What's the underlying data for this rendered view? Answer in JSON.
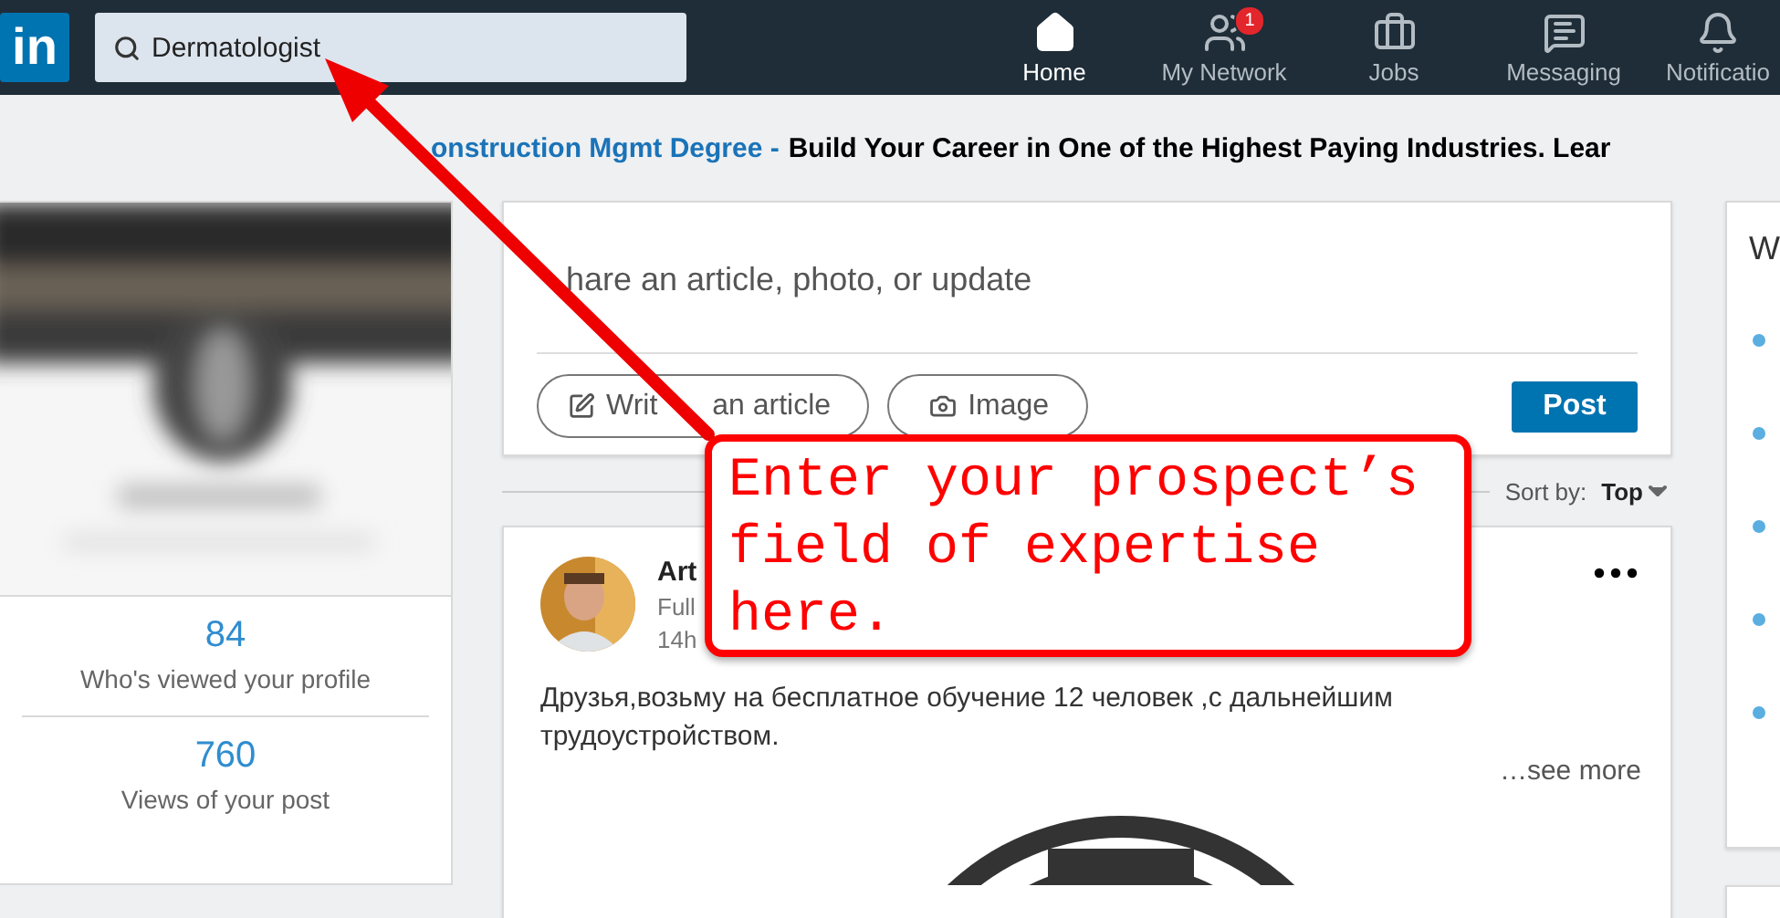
{
  "nav": {
    "logo": "in",
    "search": {
      "value": "Dermatologist"
    },
    "items": [
      {
        "label": "Home",
        "selected": true
      },
      {
        "label": "My Network",
        "selected": false,
        "badge": "1"
      },
      {
        "label": "Jobs",
        "selected": false
      },
      {
        "label": "Messaging",
        "selected": false
      },
      {
        "label": "Notificatio",
        "selected": false
      }
    ]
  },
  "ad": {
    "link": "onstruction Mgmt Degree -",
    "text": "Build Your Career in One of the Highest Paying Industries. Lear"
  },
  "profile": {
    "stats": [
      {
        "value": "84",
        "label": "Who's viewed your profile"
      },
      {
        "value": "760",
        "label": "Views of your post"
      }
    ]
  },
  "share": {
    "placeholder": "hare an article, photo, or update",
    "actions": [
      {
        "kind": "write",
        "label": [
          "Writ",
          "an article"
        ]
      },
      {
        "label": "Image"
      }
    ],
    "post_button": "Post"
  },
  "sort": {
    "label": "Sort by:",
    "value": "Top"
  },
  "post": {
    "author": "Art",
    "headline": "Full",
    "time": "14h",
    "text": "Друзья,возьму на бесплатное обучение 12 человек ,с дальнейшим трудоустройством.",
    "see_more": "…see more"
  },
  "right": {
    "title": "W"
  },
  "callout": {
    "text": "Enter your prospect’s field of expertise here."
  }
}
